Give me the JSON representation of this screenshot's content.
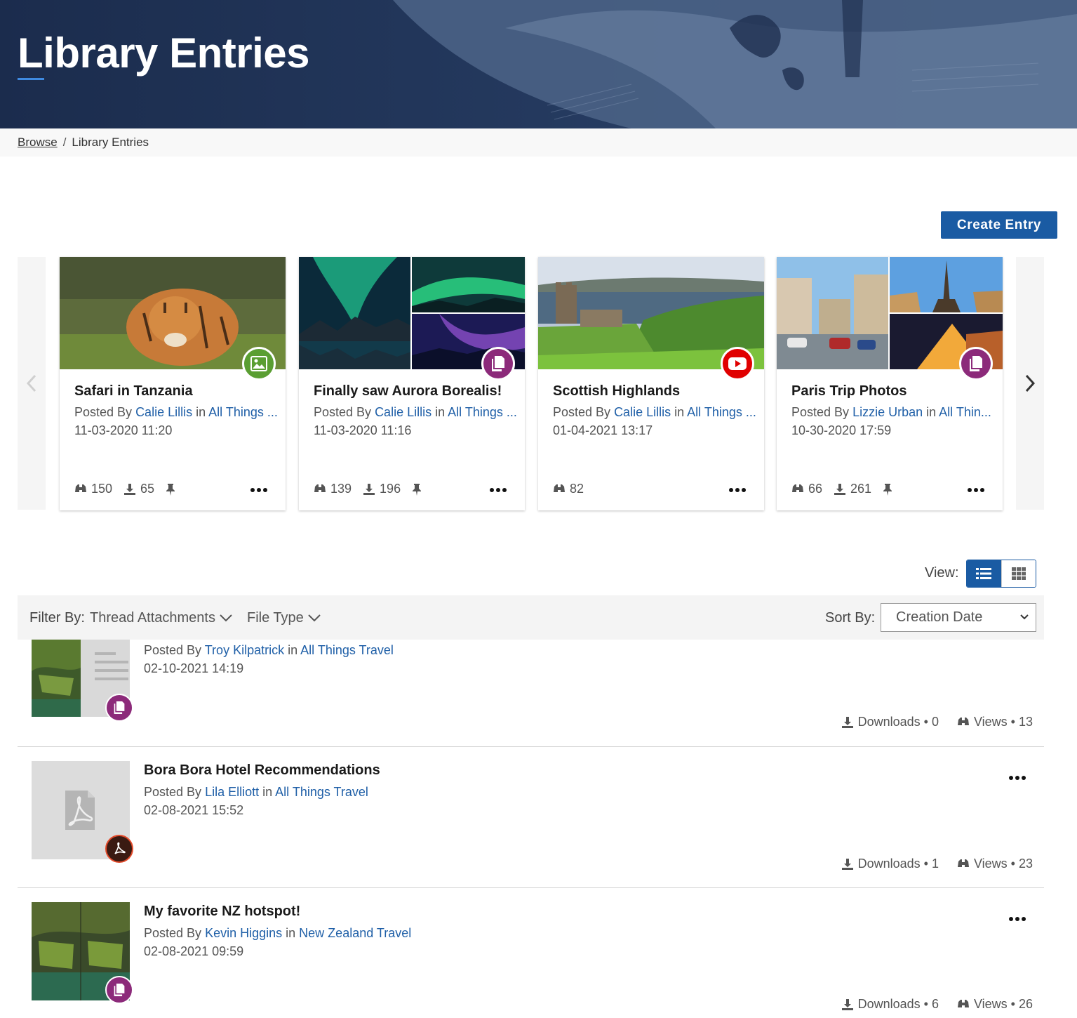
{
  "header": {
    "title": "Library Entries"
  },
  "breadcrumb": {
    "root": "Browse",
    "separator": "/",
    "current": "Library Entries"
  },
  "actions": {
    "create_entry": "Create Entry"
  },
  "featured": [
    {
      "title": "Safari in Tanzania",
      "posted_by": "Posted By",
      "author": "Calie Lillis",
      "in": "in",
      "community": "All Things ...",
      "date": "11-03-2020 11:20",
      "views": "150",
      "downloads": "65",
      "badge": "image-icon",
      "badge_color": "#5a9e32"
    },
    {
      "title": "Finally saw Aurora Borealis!",
      "posted_by": "Posted By",
      "author": "Calie Lillis",
      "in": "in",
      "community": "All Things ...",
      "date": "11-03-2020 11:16",
      "views": "139",
      "downloads": "196",
      "badge": "copy-icon",
      "badge_color": "#8c2a7a"
    },
    {
      "title": "Scottish Highlands",
      "posted_by": "Posted By",
      "author": "Calie Lillis",
      "in": "in",
      "community": "All Things ...",
      "date": "01-04-2021 13:17",
      "views": "82",
      "badge": "youtube-icon",
      "badge_color": "#e00000"
    },
    {
      "title": "Paris Trip Photos",
      "posted_by": "Posted By",
      "author": "Lizzie Urban",
      "in": "in",
      "community": "All Thin...",
      "date": "10-30-2020 17:59",
      "views": "66",
      "downloads": "261",
      "badge": "copy-icon",
      "badge_color": "#8c2a7a"
    }
  ],
  "view": {
    "label": "View:",
    "active": "list"
  },
  "filters": {
    "label": "Filter By:",
    "thread_attachments": "Thread Attachments",
    "file_type": "File Type",
    "sort_label": "Sort By:",
    "sort_value": "Creation Date"
  },
  "entries": [
    {
      "title": "",
      "posted_by": "Posted By",
      "author": "Troy Kilpatrick",
      "in": "in",
      "community": "All Things Travel",
      "date": "02-10-2021 14:19",
      "downloads": "Downloads • 0",
      "views": "Views • 13",
      "badge": "copy-icon"
    },
    {
      "title": "Bora Bora Hotel Recommendations",
      "posted_by": "Posted By",
      "author": "Lila Elliott",
      "in": "in",
      "community": "All Things Travel",
      "date": "02-08-2021 15:52",
      "downloads": "Downloads • 1",
      "views": "Views • 23",
      "badge": "pdf-icon"
    },
    {
      "title": "My favorite NZ hotspot!",
      "posted_by": "Posted By",
      "author": "Kevin Higgins",
      "in": "in",
      "community": "New Zealand Travel",
      "date": "02-08-2021 09:59",
      "downloads": "Downloads • 6",
      "views": "Views • 26",
      "badge": "copy-icon"
    }
  ],
  "colors": {
    "brand": "#1a5ba3",
    "link": "#1f5fa7",
    "hero": "#1e3152",
    "copy_badge": "#8c2a7a",
    "pdf_badge": "#3a1a12"
  }
}
